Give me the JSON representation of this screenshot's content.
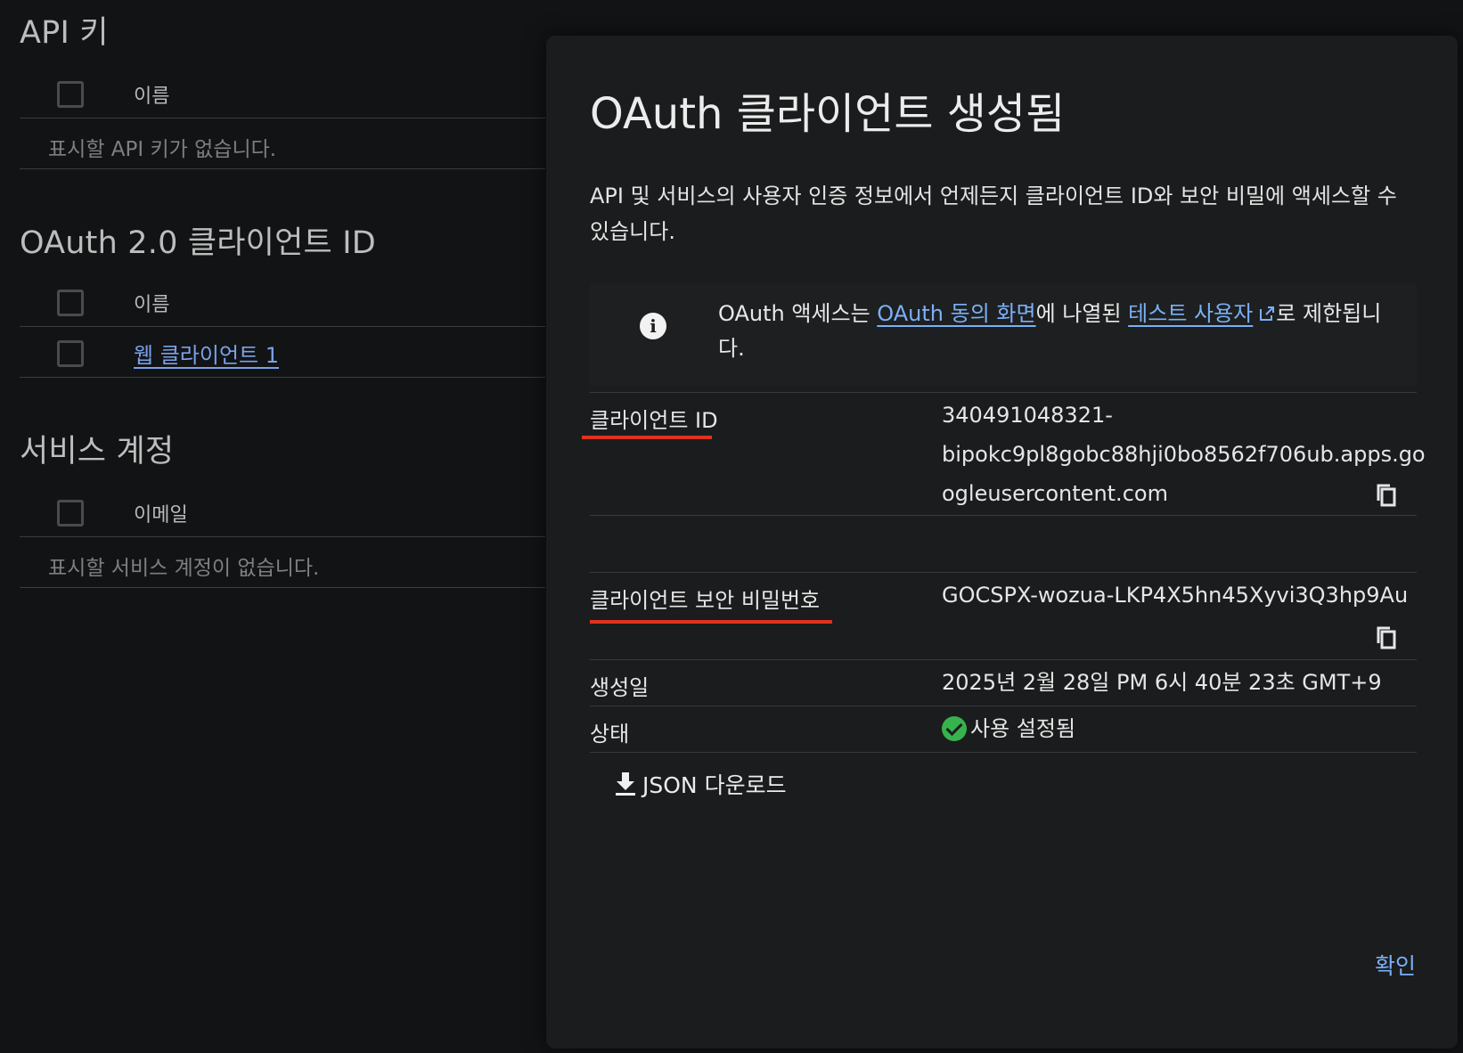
{
  "left": {
    "api_keys": {
      "title": "API 키",
      "col_name": "이름",
      "empty": "표시할 API 키가 없습니다."
    },
    "oauth": {
      "title": "OAuth 2.0 클라이언트 ID",
      "col_name": "이름",
      "rows": [
        "웹 클라이언트 1"
      ]
    },
    "service_accounts": {
      "title": "서비스 계정",
      "col_email": "이메일",
      "empty": "표시할 서비스 계정이 없습니다."
    }
  },
  "dialog": {
    "title": "OAuth 클라이언트 생성됨",
    "description": "API 및 서비스의 사용자 인증 정보에서 언제든지 클라이언트 ID와 보안 비밀에 액세스할 수 있습니다.",
    "info": {
      "prefix": "OAuth 액세스는 ",
      "link1": "OAuth 동의 화면",
      "middle": "에 나열된 ",
      "link2": "테스트 사용자",
      "suffix": "로 제한됩니다."
    },
    "client_id": {
      "label": "클라이언트 ID",
      "line1": "340491048321-",
      "line2": "bipokc9pl8gobc88hji0bo8562f706ub.apps.go",
      "line3": "ogleusercontent.com"
    },
    "client_secret": {
      "label": "클라이언트 보안 비밀번호",
      "value": "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"
    },
    "created": {
      "label": "생성일",
      "value": "2025년 2월 28일 PM 6시 40분 23초 GMT+9"
    },
    "status": {
      "label": "상태",
      "value": "사용 설정됨"
    },
    "json_button": "JSON 다운로드",
    "confirm_button": "확인"
  },
  "colors": {
    "accent_link": "#7ab0f7",
    "highlight_red": "#e0321e",
    "status_green": "#37b24d",
    "dialog_bg": "#1b1c1d"
  }
}
